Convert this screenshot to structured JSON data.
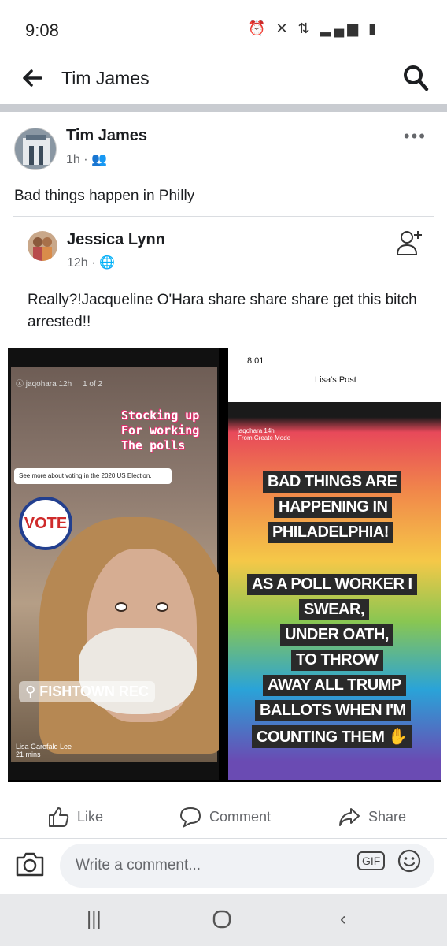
{
  "status_bar": {
    "time": "9:08"
  },
  "topbar": {
    "title": "Tim James"
  },
  "post": {
    "author": "Tim James",
    "time": "1h",
    "text": "Bad things happen in Philly",
    "shared": {
      "author": "Jessica Lynn",
      "time": "12h",
      "text": "Really?!Jacqueline O'Hara share share share get this bitch arrested!!",
      "story_left": {
        "user": "jaqohara",
        "time": "12h",
        "counter": "1 of 2",
        "sticker_lines": [
          "Stocking up",
          "For working",
          "The polls"
        ],
        "vote_prompt": "See more about voting in the 2020 US Election.",
        "vote_sticker": "VOTE",
        "location": "FISHTOWN REC",
        "poster": "Lisa Garofalo Lee",
        "poster_time": "21 mins"
      },
      "story_right": {
        "phone_time": "8:01",
        "title": "Lisa's Post",
        "user": "jaqohara",
        "time": "14h",
        "mode": "From Create Mode",
        "caption_lines": [
          "BAD THINGS ARE",
          "HAPPENING IN",
          "PHILADELPHIA!",
          "AS A POLL WORKER I",
          "SWEAR,",
          "UNDER OATH,",
          "TO THROW",
          "AWAY ALL TRUMP",
          "BALLOTS WHEN I'M",
          "COUNTING THEM ✋"
        ]
      }
    },
    "actions": {
      "like": "Like",
      "comment": "Comment",
      "share": "Share"
    }
  },
  "comment_box": {
    "placeholder": "Write a comment...",
    "gif": "GIF"
  },
  "colors": {
    "divider": "#c9ccd1",
    "meta": "#65676b",
    "nav": "#e8e9eb"
  },
  "icons": [
    "back-arrow-icon",
    "search-icon",
    "more-icon",
    "friends-icon",
    "globe-icon",
    "add-friend-icon",
    "like-icon",
    "comment-icon",
    "share-icon",
    "camera-icon",
    "gif-icon",
    "emoji-icon",
    "recents-icon",
    "home-icon",
    "back-nav-icon"
  ]
}
